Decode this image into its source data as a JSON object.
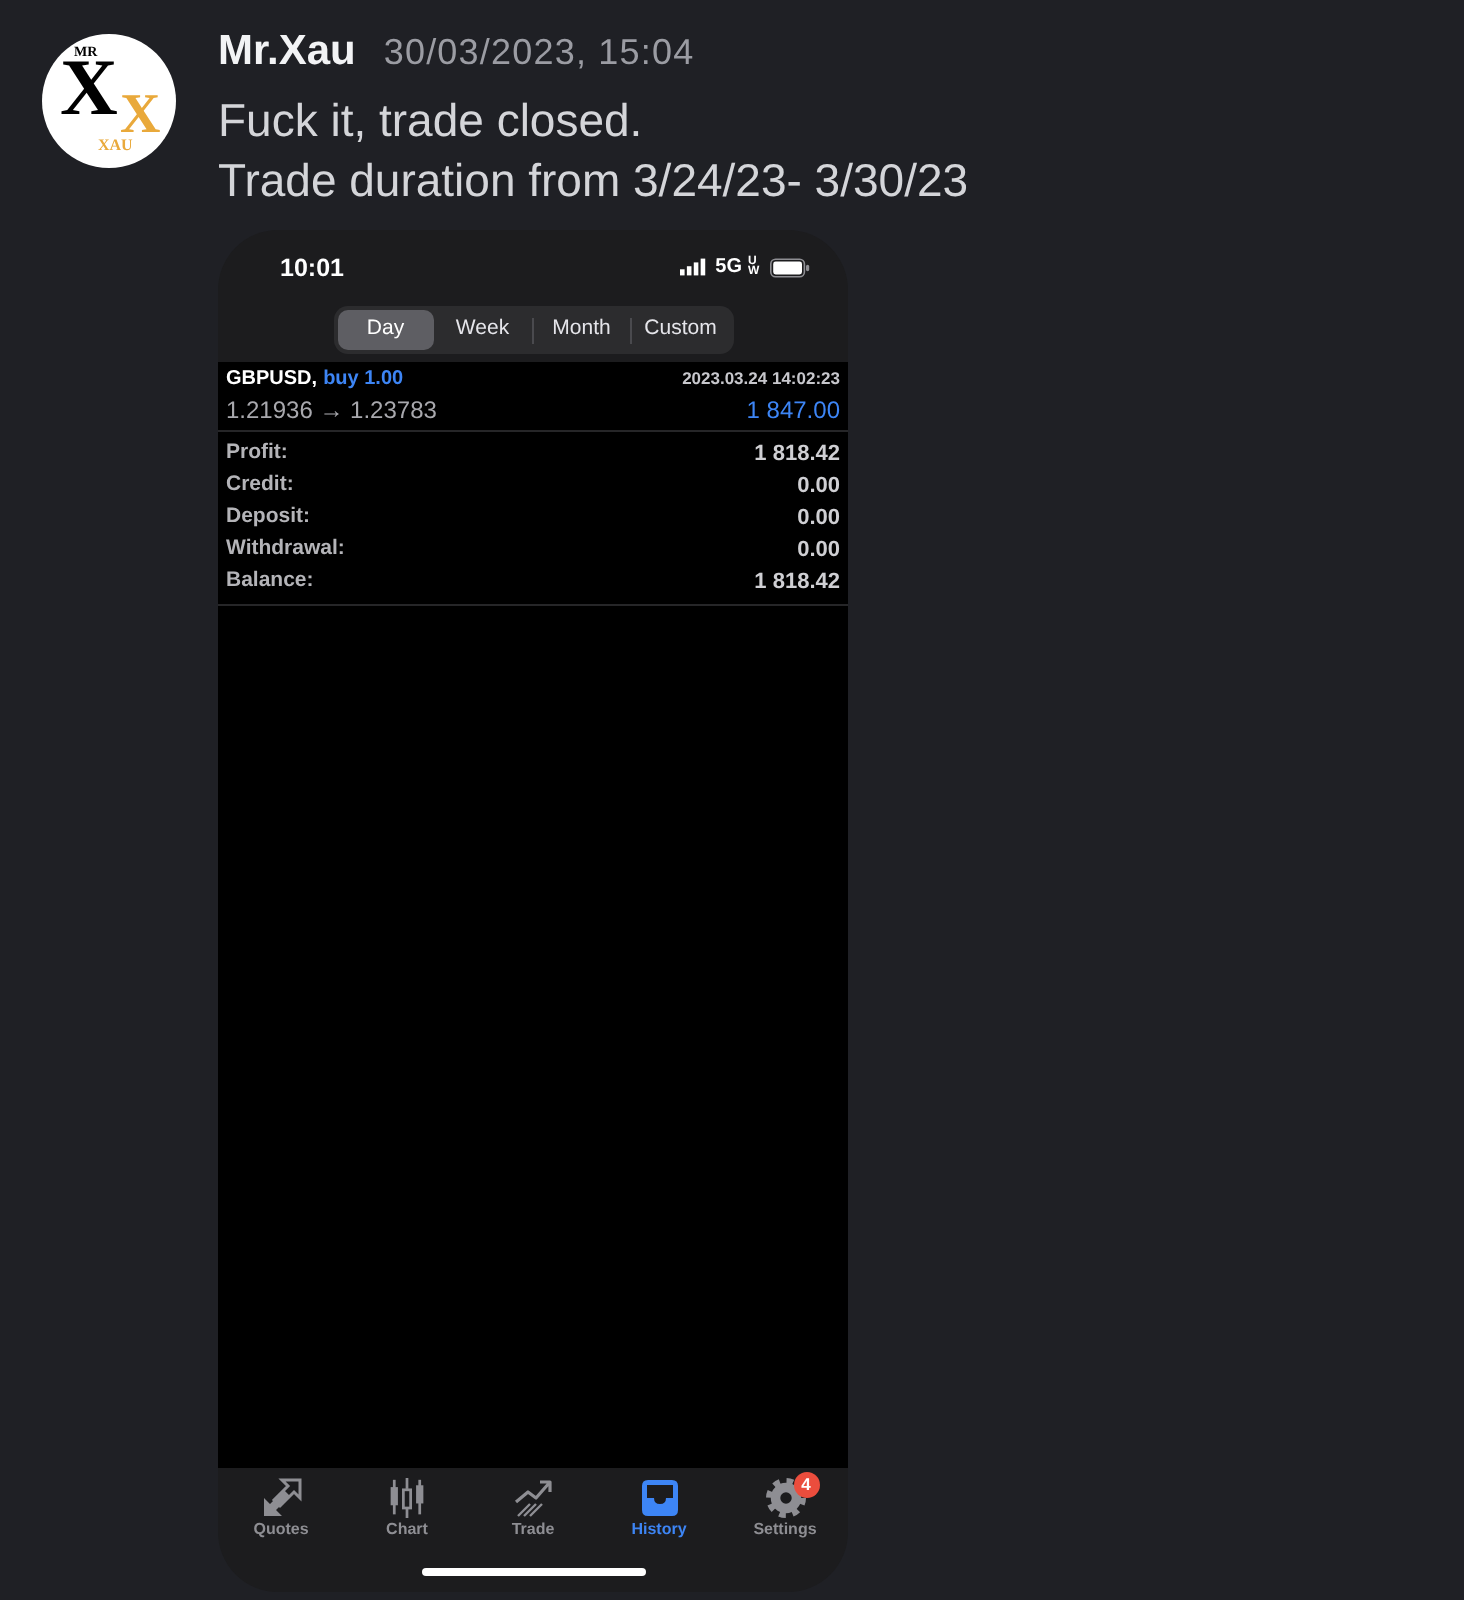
{
  "message": {
    "avatar": {
      "top_text": "MR",
      "letter": "X",
      "letter_accent": "X",
      "bottom_text": "XAU"
    },
    "author": "Mr.Xau",
    "timestamp": "30/03/2023, 15:04",
    "lines": [
      "Fuck it, trade closed.",
      "Trade duration from 3/24/23- 3/30/23"
    ]
  },
  "screenshot": {
    "status_bar": {
      "time": "10:01",
      "network": "5G",
      "network_suffix": "UW"
    },
    "period_tabs": [
      {
        "label": "Day",
        "selected": true
      },
      {
        "label": "Week",
        "selected": false
      },
      {
        "label": "Month",
        "selected": false
      },
      {
        "label": "Custom",
        "selected": false
      }
    ],
    "trade": {
      "symbol": "GBPUSD,",
      "side": "buy 1.00",
      "time": "2023.03.24 14:02:23",
      "prices": "1.21936 → 1.23783",
      "result": "1 847.00"
    },
    "summary": [
      {
        "label": "Profit:",
        "value": "1 818.42"
      },
      {
        "label": "Credit:",
        "value": "0.00"
      },
      {
        "label": "Deposit:",
        "value": "0.00"
      },
      {
        "label": "Withdrawal:",
        "value": "0.00"
      },
      {
        "label": "Balance:",
        "value": "1 818.42"
      }
    ],
    "tab_bar": [
      {
        "kind": "quotes",
        "label": "Quotes",
        "selected": false
      },
      {
        "kind": "chart",
        "label": "Chart",
        "selected": false
      },
      {
        "kind": "trade",
        "label": "Trade",
        "selected": false
      },
      {
        "kind": "history",
        "label": "History",
        "selected": true
      },
      {
        "kind": "settings",
        "label": "Settings",
        "selected": false,
        "badge": "4"
      }
    ]
  }
}
